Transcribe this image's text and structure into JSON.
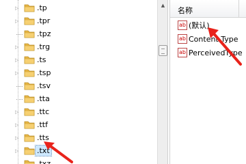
{
  "tree": {
    "items": [
      {
        "label": ".tp",
        "expandable": true
      },
      {
        "label": ".tpr",
        "expandable": true
      },
      {
        "label": ".tpz",
        "expandable": false
      },
      {
        "label": ".trg",
        "expandable": true
      },
      {
        "label": ".ts",
        "expandable": true
      },
      {
        "label": ".tsp",
        "expandable": true
      },
      {
        "label": ".tsv",
        "expandable": false
      },
      {
        "label": ".tta",
        "expandable": false
      },
      {
        "label": ".ttc",
        "expandable": true
      },
      {
        "label": ".ttf",
        "expandable": true
      },
      {
        "label": ".tts",
        "expandable": true
      },
      {
        "label": ".txt",
        "expandable": true,
        "selected": true
      },
      {
        "label": ".txz",
        "expandable": false
      }
    ]
  },
  "values": {
    "header_name": "名称",
    "items": [
      {
        "label": "(默认)",
        "icon": "ab-string-icon"
      },
      {
        "label": "Content Type",
        "icon": "ab-string-icon"
      },
      {
        "label": "PerceivedType",
        "icon": "ab-string-icon"
      }
    ]
  },
  "colors": {
    "arrow": "#e8231b",
    "folder": "#e9b746",
    "selection": "#cde8ff"
  }
}
